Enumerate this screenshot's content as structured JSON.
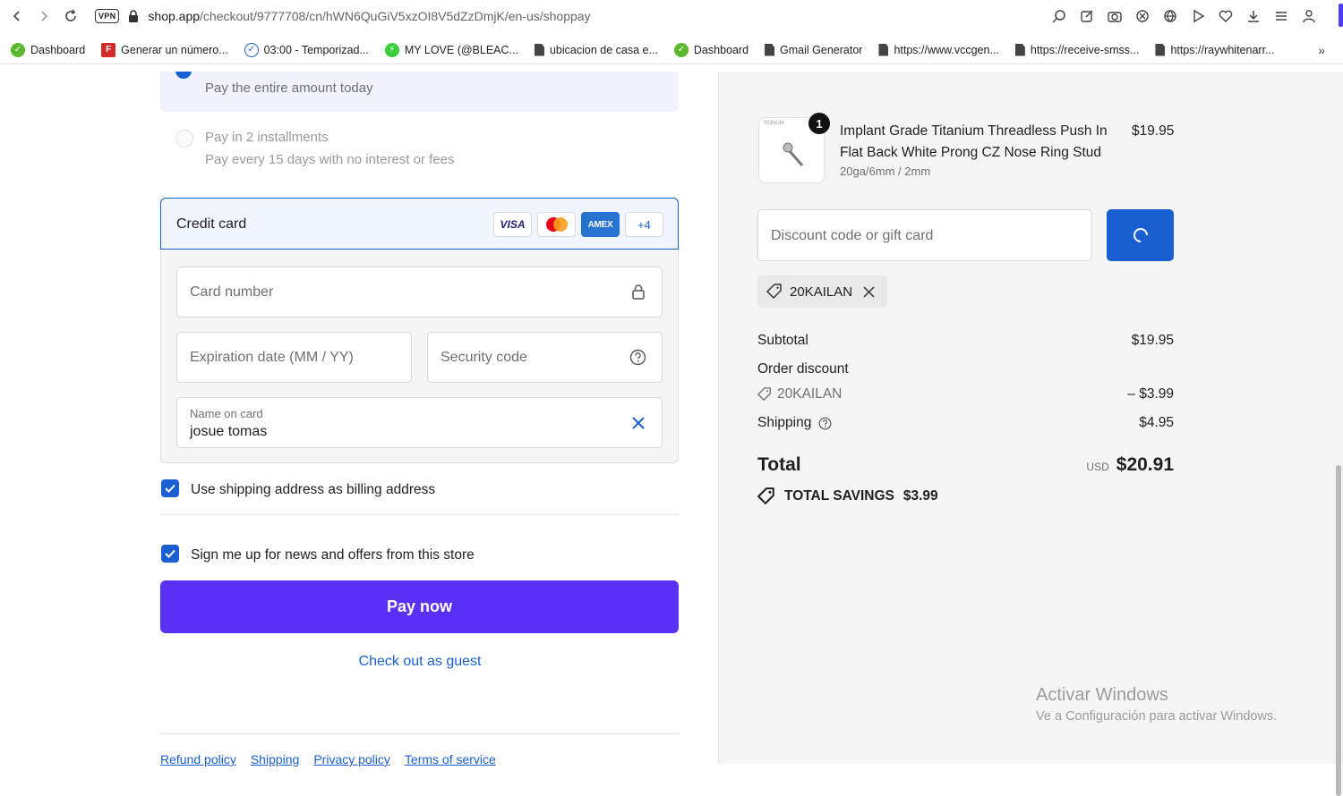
{
  "browser": {
    "url_host": "shop.app",
    "url_path": "/checkout/9777708/cn/hWN6QuGiV5xzOI8V5dZzDmjK/en-us/shoppay",
    "vpn_label": "VPN",
    "bookmarks": [
      {
        "label": "Dashboard",
        "icon": "green-check"
      },
      {
        "label": "Generar un número...",
        "icon": "red-f"
      },
      {
        "label": "03:00 - Temporizad...",
        "icon": "timer"
      },
      {
        "label": "MY LOVE (@BLEAC...",
        "icon": "green-bolt"
      },
      {
        "label": "ubicacion de casa e...",
        "icon": "doc"
      },
      {
        "label": "Dashboard",
        "icon": "green-check"
      },
      {
        "label": "Gmail Generator",
        "icon": "doc"
      },
      {
        "label": "https://www.vccgen...",
        "icon": "doc"
      },
      {
        "label": "https://receive-smss...",
        "icon": "doc"
      },
      {
        "label": "https://raywhitenarr...",
        "icon": "doc"
      }
    ]
  },
  "payment_options": {
    "full": {
      "desc": "Pay the entire amount today"
    },
    "installments": {
      "title": "Pay in 2 installments",
      "desc": "Pay every 15 days with no interest or fees"
    }
  },
  "credit_card": {
    "title": "Credit card",
    "logos": {
      "visa": "VISA",
      "amex": "AMEX",
      "more": "+4"
    },
    "card_number_placeholder": "Card number",
    "expiration_placeholder": "Expiration date (MM / YY)",
    "security_placeholder": "Security code",
    "name_label": "Name on card",
    "name_value": "josue tomas"
  },
  "checkboxes": {
    "billing": "Use shipping address as billing address",
    "newsletter": "Sign me up for news and offers from this store"
  },
  "pay_button": "Pay now",
  "guest_link": "Check out as guest",
  "footer_links": [
    "Refund policy",
    "Shipping",
    "Privacy policy",
    "Terms of service"
  ],
  "summary": {
    "product": {
      "thumb_brand": "®ONUM",
      "quantity": "1",
      "name": "Implant Grade Titanium Threadless Push In Flat Back White Prong CZ Nose Ring Stud",
      "variant": "20ga/6mm / 2mm",
      "price": "$19.95"
    },
    "discount_placeholder": "Discount code or gift card",
    "applied_code": "20KAILAN",
    "subtotal_label": "Subtotal",
    "subtotal_value": "$19.95",
    "order_discount_label": "Order discount",
    "discount_code": "20KAILAN",
    "discount_value": "– $3.99",
    "shipping_label": "Shipping",
    "shipping_value": "$4.95",
    "total_label": "Total",
    "currency": "USD",
    "total_value": "$20.91",
    "savings_label": "TOTAL SAVINGS",
    "savings_value": "$3.99"
  },
  "watermark": {
    "title": "Activar Windows",
    "subtitle": "Ve a Configuración para activar Windows."
  },
  "colors": {
    "accent_blue": "#1a5fd1",
    "shop_purple": "#5a31f4"
  }
}
